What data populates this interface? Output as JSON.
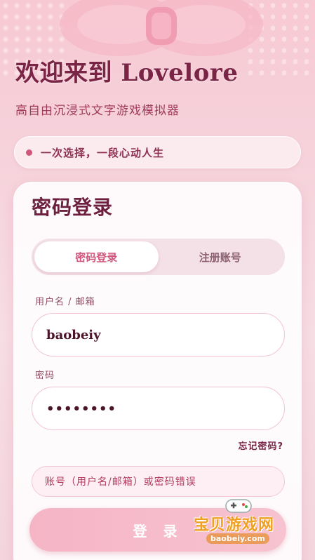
{
  "hero": {
    "title": "欢迎来到 Lovelore",
    "subtitle": "高自由沉浸式文字游戏模拟器",
    "tagline": "一次选择，一段心动人生"
  },
  "card": {
    "title": "密码登录",
    "tabs": [
      {
        "label": "密码登录",
        "active": true
      },
      {
        "label": "注册账号",
        "active": false
      }
    ],
    "username_label": "用户名 / 邮箱",
    "username_value": "baobeiy",
    "password_label": "密码",
    "password_value": "••••••••",
    "forgot_label": "忘记密码?",
    "error_text": "账号（用户名/邮箱）或密码错误",
    "login_button": "登 录"
  },
  "watermark": {
    "brand": "宝贝游戏网",
    "url": "baobeiy.com"
  },
  "colors": {
    "accent": "#d0587e",
    "title": "#7a2446",
    "button": "#f5b5c6"
  }
}
